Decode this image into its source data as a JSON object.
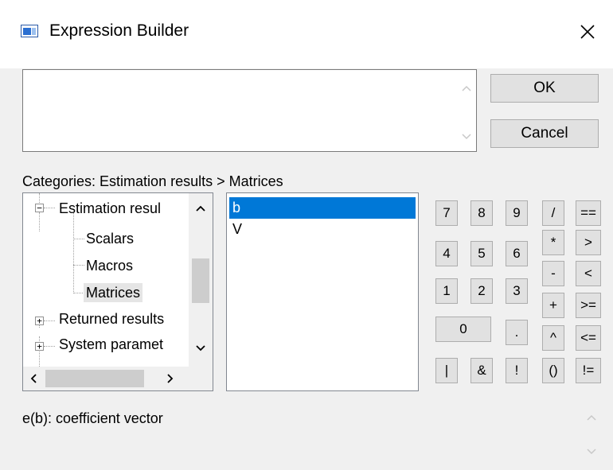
{
  "window": {
    "title": "Expression Builder",
    "close_icon": "close-icon",
    "app_icon": "expression-builder-app-icon"
  },
  "expression": {
    "value": ""
  },
  "buttons": {
    "ok": "OK",
    "cancel": "Cancel"
  },
  "categories_label": "Categories: Estimation results > Matrices",
  "tree": {
    "items": [
      {
        "label": "Estimation resul",
        "expander": "−"
      },
      {
        "label": "Scalars"
      },
      {
        "label": "Macros"
      },
      {
        "label": "Matrices",
        "selected": true
      },
      {
        "label": "Returned results",
        "expander": "+"
      },
      {
        "label": "System paramet",
        "expander": "+"
      }
    ]
  },
  "list": {
    "items": [
      {
        "label": "b",
        "selected": true
      },
      {
        "label": "V"
      }
    ]
  },
  "keypad": {
    "digits": [
      "7",
      "8",
      "9",
      "4",
      "5",
      "6",
      "1",
      "2",
      "3",
      "0",
      "."
    ],
    "logic": [
      "|",
      "&",
      "!"
    ],
    "operators": [
      "/",
      "==",
      "*",
      ">",
      "-",
      "<",
      "+",
      ">=",
      "^",
      "<=",
      "()",
      "!="
    ]
  },
  "description": "e(b):  coefficient vector",
  "colors": {
    "selection": "#0078d7",
    "window_bg": "#f0f0f0",
    "button_bg": "#e1e1e1",
    "button_border": "#adadad"
  }
}
